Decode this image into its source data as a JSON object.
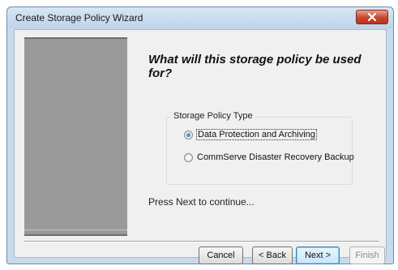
{
  "window": {
    "title": "Create Storage Policy Wizard"
  },
  "content": {
    "heading": "What will this storage policy be used for?",
    "group_label": "Storage Policy Type",
    "options": [
      {
        "label": "Data Protection and Archiving",
        "selected": true
      },
      {
        "label": "CommServe Disaster Recovery Backup",
        "selected": false
      }
    ],
    "instruction": "Press Next to continue..."
  },
  "buttons": {
    "cancel": "Cancel",
    "back": "< Back",
    "next": "Next >",
    "finish": "Finish"
  },
  "icons": {
    "close": "close-icon"
  },
  "colors": {
    "title_bar": "#c9daec",
    "close_button": "#c9462c",
    "side_panel": "#9a9a9a",
    "client_bg": "#f0f0f0"
  }
}
